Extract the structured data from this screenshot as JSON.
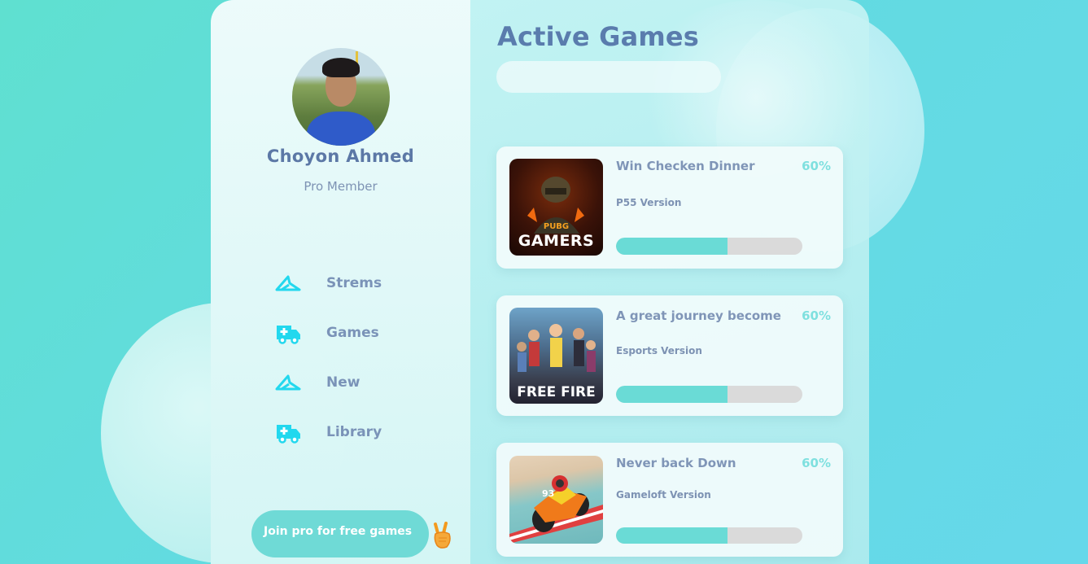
{
  "profile": {
    "name": "Choyon Ahmed",
    "role": "Pro Member"
  },
  "nav": {
    "items": [
      {
        "label": "Strems",
        "icon": "plane-icon"
      },
      {
        "label": "Games",
        "icon": "ambulance-icon"
      },
      {
        "label": "New",
        "icon": "plane-icon"
      },
      {
        "label": "Library",
        "icon": "ambulance-icon"
      }
    ]
  },
  "cta": {
    "join_label": "Join pro for free games",
    "emoji_icon": "peace-hand-icon"
  },
  "main": {
    "title": "Active Games",
    "search_placeholder": ""
  },
  "games": [
    {
      "title": "Win Checken Dinner",
      "percent_label": "60%",
      "progress": 0.6,
      "version": "P55 Version",
      "thumb_text_1": "PUBG",
      "thumb_text_2": "GAMERS"
    },
    {
      "title": "A great journey become",
      "percent_label": "60%",
      "progress": 0.6,
      "version": "Esports Version",
      "thumb_text_1": "FREE FIRE"
    },
    {
      "title": "Never back Down",
      "percent_label": "60%",
      "progress": 0.6,
      "version": "Gameloft Version",
      "thumb_text_1": "93"
    }
  ],
  "colors": {
    "accent": "#6adbd6",
    "title": "#5a7cad",
    "nav_icon": "#22d8ee"
  }
}
